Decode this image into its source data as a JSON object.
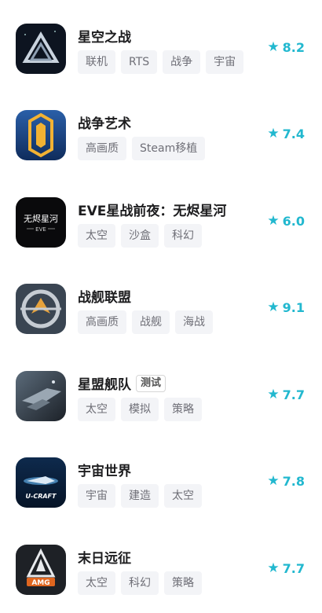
{
  "games": [
    {
      "title": "星空之战",
      "badge": "",
      "tags": [
        "联机",
        "RTS",
        "战争",
        "宇宙"
      ],
      "rating": "8.2",
      "icon": "triangle-logo-icon"
    },
    {
      "title": "战争艺术",
      "badge": "",
      "tags": [
        "高画质",
        "Steam移植"
      ],
      "rating": "7.4",
      "icon": "gold-emblem-icon"
    },
    {
      "title": "EVE星战前夜：无烬星河",
      "badge": "",
      "tags": [
        "太空",
        "沙盒",
        "科幻"
      ],
      "rating": "6.0",
      "icon": "eve-logo-icon",
      "icon_text": [
        "无烬星河",
        "EVE"
      ]
    },
    {
      "title": "战舰联盟",
      "badge": "",
      "tags": [
        "高画质",
        "战舰",
        "海战"
      ],
      "rating": "9.1",
      "icon": "warship-emblem-icon"
    },
    {
      "title": "星盟舰队",
      "badge": "测试",
      "tags": [
        "太空",
        "模拟",
        "策略"
      ],
      "rating": "7.7",
      "icon": "space-fleet-icon"
    },
    {
      "title": "宇宙世界",
      "badge": "",
      "tags": [
        "宇宙",
        "建造",
        "太空"
      ],
      "rating": "7.8",
      "icon": "ucraft-icon",
      "icon_text": [
        "U-CRAFT"
      ]
    },
    {
      "title": "末日远征",
      "badge": "",
      "tags": [
        "太空",
        "科幻",
        "策略"
      ],
      "rating": "7.7",
      "icon": "amg-logo-icon",
      "icon_text": [
        "AMG"
      ]
    }
  ],
  "colors": {
    "rating": "#22b8cf",
    "tag_bg": "#f3f4f7",
    "tag_text": "#6f6f77"
  }
}
